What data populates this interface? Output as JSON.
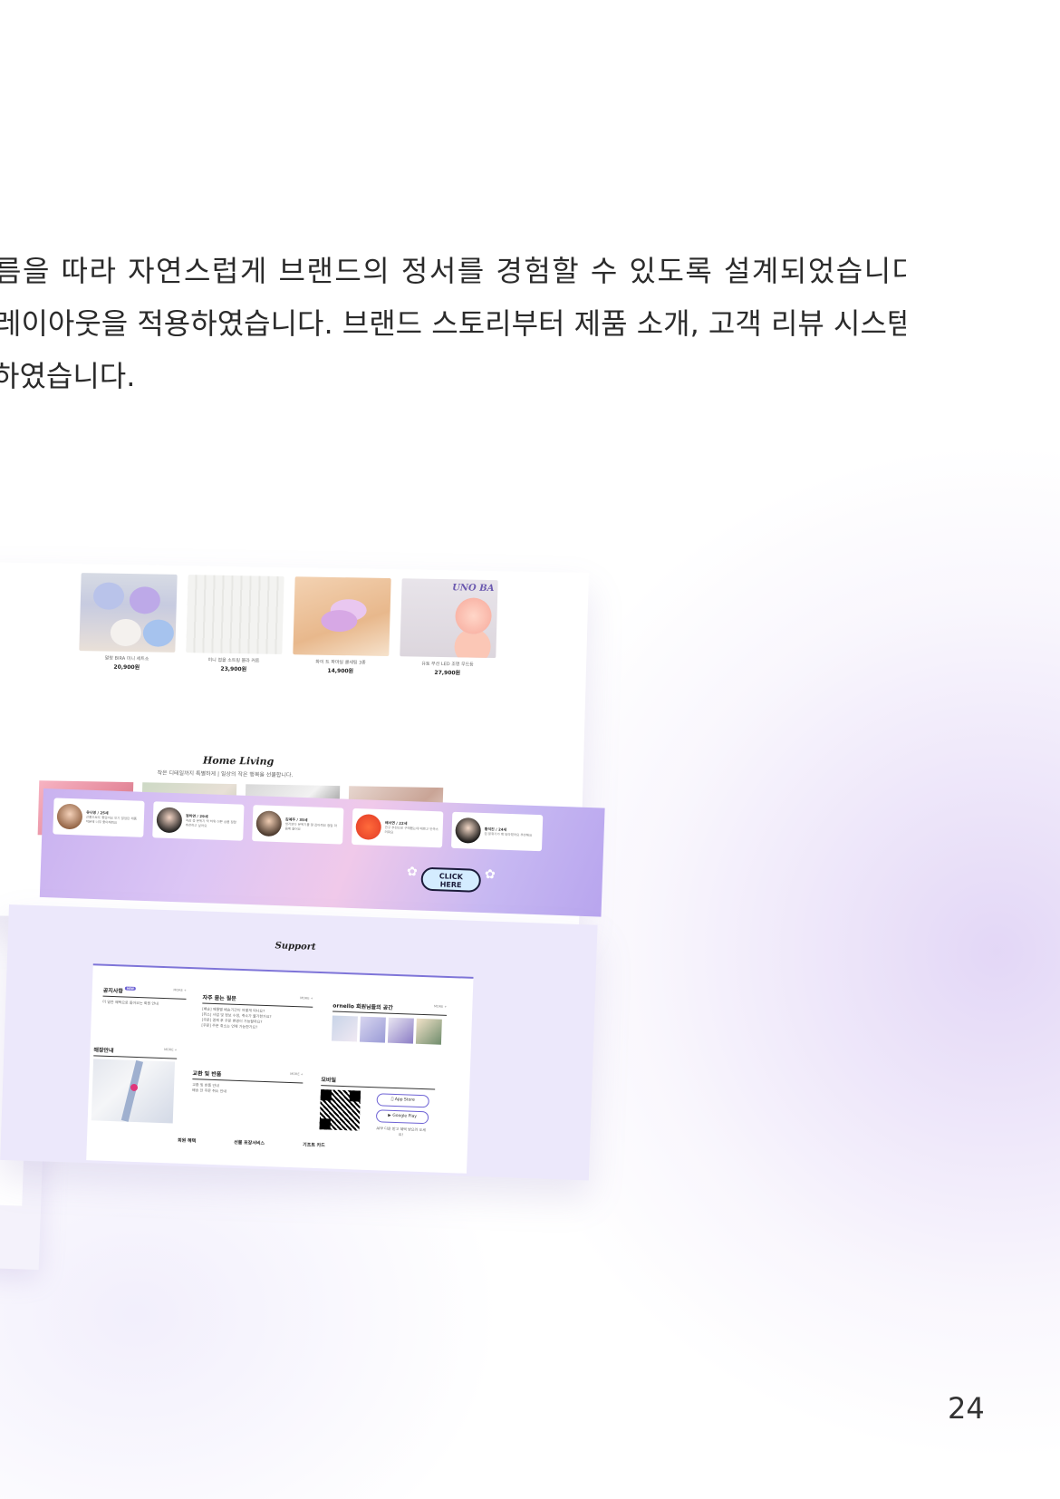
{
  "intro": {
    "line1": "름을 따라 자연스럽게 브랜드의 정서를 경험할 수 있도록 설계되었습니다.",
    "line2": "레이아웃을 적용하였습니다. 브랜드 스토리부터 제품 소개, 고객 리뷰 시스템까지",
    "line3": "하였습니다."
  },
  "page_number": "24",
  "products": [
    {
      "name": "말랑 BIRA 미니 세트소",
      "price": "20,900원"
    },
    {
      "name": "미니 접을 소트링 블라 커튼",
      "price": "23,900원"
    },
    {
      "name": "화이 트 파마일 클세팅 3종",
      "price": "14,900원"
    },
    {
      "name": "유토 무선 LED 조명 무드등",
      "price": "27,900원",
      "brand": "UNO BA"
    }
  ],
  "home_living": {
    "title": "Home Living",
    "subtitle": "작은 디테일까지 특별하게 | 일상의 작은 행복을 선물합니다."
  },
  "reviews": [
    {
      "name": "유나영 / 25세",
      "text": "선물으로도 좋았어요 인기 많았던 제품 덕분에 너무 좋아해줘요"
    },
    {
      "name": "정하연 / 29세",
      "text": "직감 중 분위기 딱 하위 이쁜 상품 정말 추천하고 싶어요"
    },
    {
      "name": "김예주 / 35세",
      "text": "생각보다 분위기를 잘 잡아줘요 정말 마음에 들어요"
    },
    {
      "name": "배서연 / 22세",
      "text": "친구 추천으로 구매했는데 예쁘고 만족스러워요"
    },
    {
      "name": "황석진 / 24세",
      "text": "집 분위기가 확 달라졌어요 추천해요"
    }
  ],
  "click_here": {
    "line1": "CLICK",
    "line2": "HERE"
  },
  "support": {
    "title": "Support",
    "notice": {
      "heading": "공지사항",
      "badge": "NEW",
      "more": "MORE +",
      "text": "더 알찬 혜택으로 돌아오는 회원 안내"
    },
    "store": {
      "heading": "매장안내",
      "more": "MORE +"
    },
    "faq": {
      "heading": "자주 묻는 질문",
      "more": "MORE +",
      "items": [
        "[배송] 제품별 배송기간이 어떻게 되나요?",
        "[취소] 사업 및 정보 수정, 취소가 불가한가요?",
        "[주문] 결제 후 주문 변경이 가능할까요?",
        "[주문] 주문 취소는 언제 가능한가요?"
      ]
    },
    "exchange": {
      "heading": "교환 및 반품",
      "more": "MORE +",
      "items": [
        "교환 및 반품 안내",
        "배송 전 주문 취소 안내"
      ]
    },
    "community": {
      "heading": "ornello 회원님들의 공간",
      "more": "MORE +"
    },
    "mobile": {
      "heading": "모바일",
      "app_store": "App Store",
      "google_play": "Google Play",
      "note": "APP 다운 받고 혜택 받으러 오세요!"
    },
    "bottom_links": [
      "회원 혜택",
      "선물 포장서비스",
      "기프트 카드"
    ]
  }
}
